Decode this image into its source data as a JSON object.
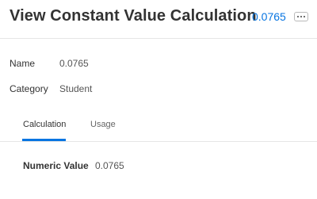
{
  "header": {
    "title": "View Constant Value Calculation",
    "value_link": "0.0765",
    "related_actions_icon": "ellipsis-icon"
  },
  "fields": {
    "name_label": "Name",
    "name_value": "0.0765",
    "category_label": "Category",
    "category_value": "Student"
  },
  "tabs": [
    {
      "label": "Calculation",
      "active": true
    },
    {
      "label": "Usage",
      "active": false
    }
  ],
  "calculation": {
    "numeric_label": "Numeric Value",
    "numeric_value": "0.0765"
  },
  "colors": {
    "accent": "#0875e1",
    "text": "#333333",
    "divider": "#e6e6e6"
  }
}
